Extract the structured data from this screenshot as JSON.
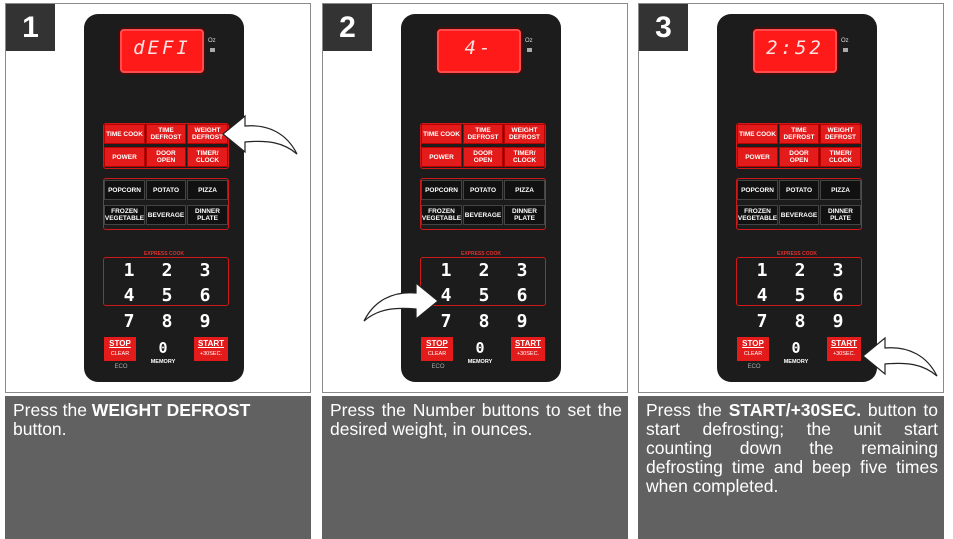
{
  "steps": [
    {
      "number": "1",
      "display": "dEFI",
      "desc_lead": "Press the ",
      "desc_bold": "WEIGHT DEFROST",
      "desc_trail": " button.",
      "arrow_target": "weight-defrost-key"
    },
    {
      "number": "2",
      "display": "4-",
      "desc_lead": "Press the Number buttons to set the desired weight, in ounces.",
      "desc_bold": "",
      "desc_trail": "",
      "arrow_target": "num-4-key"
    },
    {
      "number": "3",
      "display": "2:52",
      "desc_lead": "Press the ",
      "desc_bold": "START/+30SEC.",
      "desc_trail": " button to start defrosting; the unit start counting down the remaining defrosting time and beep five times when completed.",
      "arrow_target": "start-key"
    }
  ],
  "panel": {
    "oz_label": "Oz",
    "row1": [
      "TIME COOK",
      "TIME DEFROST",
      "WEIGHT DEFROST"
    ],
    "row2": [
      "POWER",
      "DOOR OPEN",
      "TIMER/ CLOCK"
    ],
    "row3": [
      "POPCORN",
      "POTATO",
      "PIZZA"
    ],
    "row4": [
      "FROZEN VEGETABLE",
      "BEVERAGE",
      "DINNER PLATE"
    ],
    "express_label": "EXPRESS COOK",
    "numbers": [
      "1",
      "2",
      "3",
      "4",
      "5",
      "6",
      "7",
      "8",
      "9"
    ],
    "stop_label": "STOP",
    "stop_sub": "CLEAR",
    "eco_label": "ECO",
    "zero_label": "0",
    "memory_label": "MEMORY",
    "start_label": "START",
    "start_sub": "+30SEC."
  },
  "colors": {
    "accent_red": "#e31b1b",
    "device_body": "#1c1c1c",
    "desc_bg": "#616161",
    "tag_bg": "#333333"
  }
}
